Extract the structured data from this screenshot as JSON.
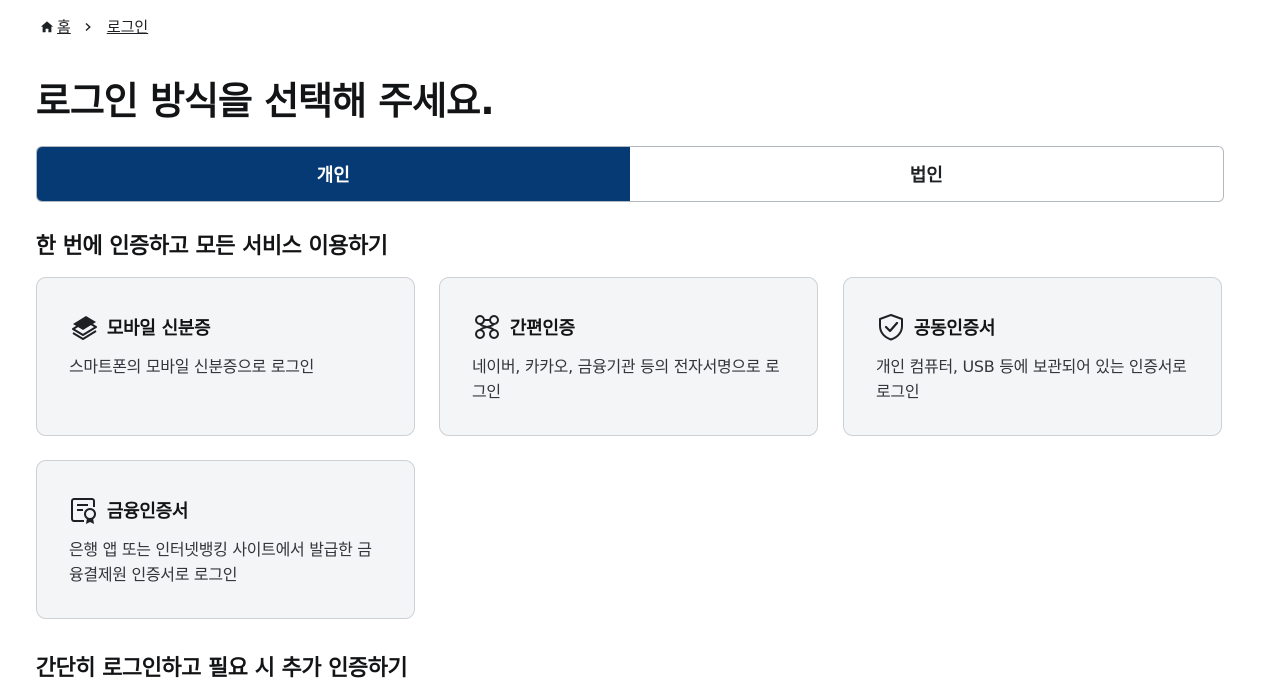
{
  "breadcrumb": {
    "home": "홈",
    "current": "로그인"
  },
  "page_title": "로그인 방식을 선택해 주세요.",
  "tabs": [
    {
      "label": "개인",
      "active": true
    },
    {
      "label": "법인",
      "active": false
    }
  ],
  "section_title": "한 번에 인증하고 모든 서비스 이용하기",
  "cards": [
    {
      "icon": "mobile-id-icon",
      "name": "모바일 신분증",
      "desc": "스마트폰의 모바일 신분증으로 로그인"
    },
    {
      "icon": "simple-auth-icon",
      "name": "간편인증",
      "desc": "네이버, 카카오, 금융기관 등의 전자서명으로 로그인"
    },
    {
      "icon": "shield-check-icon",
      "name": "공동인증서",
      "desc": "개인 컴퓨터, USB 등에 보관되어 있는 인증서로 로그인"
    },
    {
      "icon": "certificate-icon",
      "name": "금융인증서",
      "desc": "은행 앱 또는 인터넷뱅킹 사이트에서 발급한 금융결제원 인증서로 로그인"
    }
  ],
  "section_title_2": "간단히 로그인하고 필요 시 추가 인증하기",
  "colors": {
    "primary": "#063a74",
    "card_bg": "#f4f5f6",
    "border": "#cdd1d5"
  }
}
